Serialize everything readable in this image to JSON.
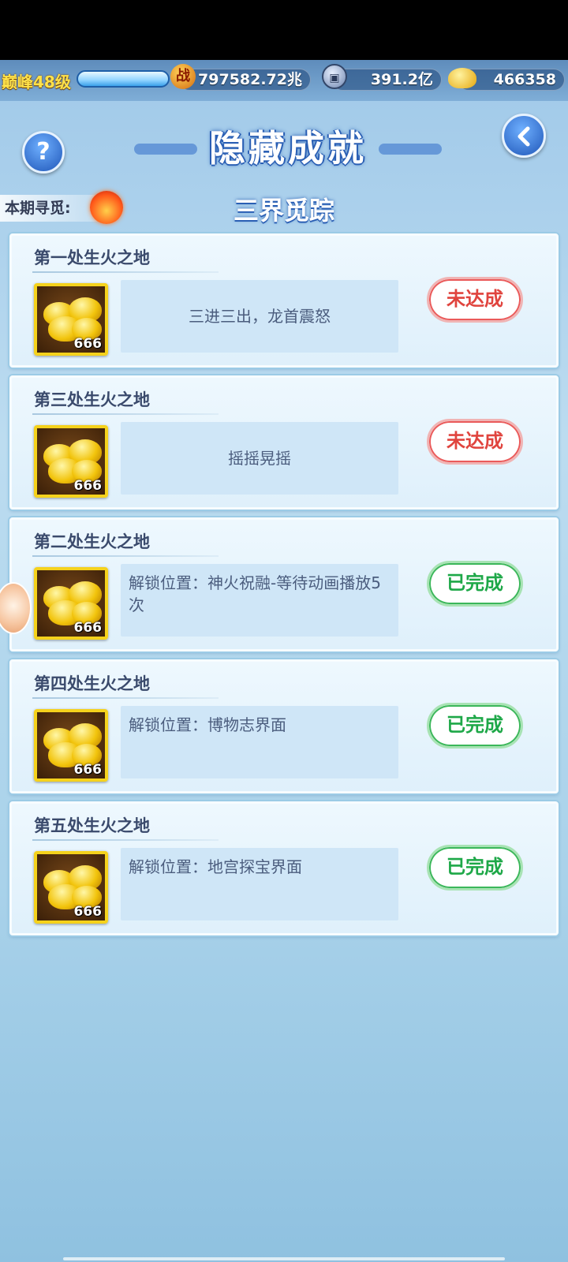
{
  "resources": {
    "level_label": "巅峰48级",
    "power_value": "797582.72兆",
    "power_icon_glyph": "战",
    "silver_value": "391.2亿",
    "gold_value": "466358"
  },
  "header": {
    "title": "隐藏成就",
    "help_glyph": "?",
    "period_label": "本期寻觅:",
    "subtitle": "三界觅踪"
  },
  "colors": {
    "pending_red": "#e0443e",
    "done_green": "#1ea848",
    "title_blue": "#2a5fb4"
  },
  "achievements": [
    {
      "title": "第一处生火之地",
      "reward_count": "666",
      "description": "三进三出，龙首震怒",
      "status": "未达成"
    },
    {
      "title": "第三处生火之地",
      "reward_count": "666",
      "description": "摇摇晃摇",
      "status": "未达成"
    },
    {
      "title": "第二处生火之地",
      "reward_count": "666",
      "description": "解锁位置：神火祝融-等待动画播放5次",
      "status": "已完成"
    },
    {
      "title": "第四处生火之地",
      "reward_count": "666",
      "description": "解锁位置：博物志界面",
      "status": "已完成"
    },
    {
      "title": "第五处生火之地",
      "reward_count": "666",
      "description": "解锁位置：地宫探宝界面",
      "status": "已完成"
    }
  ]
}
